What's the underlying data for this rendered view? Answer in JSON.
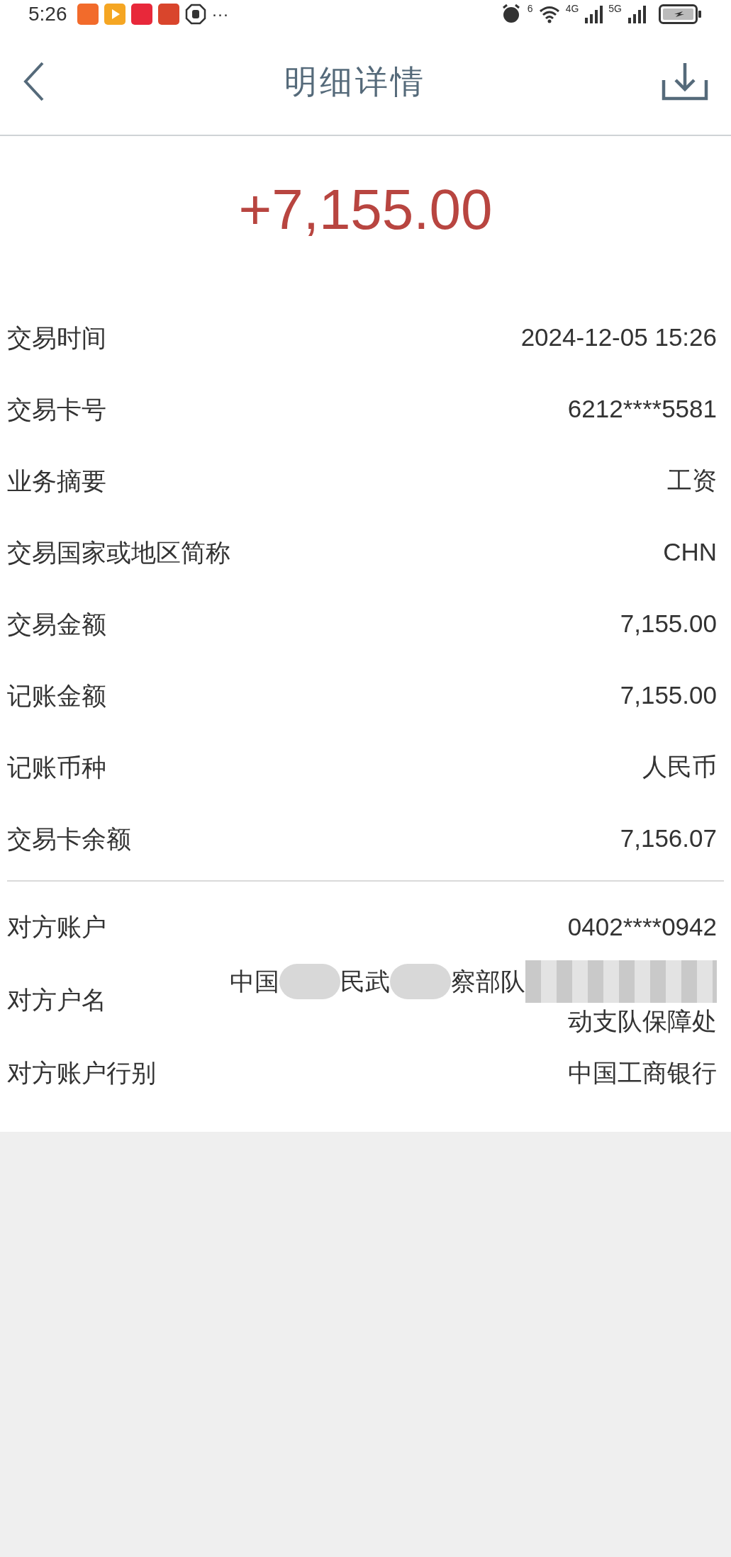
{
  "status_bar": {
    "time": "5:26",
    "more": "···",
    "wifi_badge": "6",
    "sim1": "4G",
    "sim2": "5G"
  },
  "header": {
    "title": "明细详情"
  },
  "amount": "+7,155.00",
  "details": [
    {
      "label": "交易时间",
      "value": "2024-12-05 15:26"
    },
    {
      "label": "交易卡号",
      "value": "6212****5581"
    },
    {
      "label": "业务摘要",
      "value": "工资"
    },
    {
      "label": "交易国家或地区简称",
      "value": "CHN"
    },
    {
      "label": "交易金额",
      "value": "7,155.00"
    },
    {
      "label": "记账金额",
      "value": "7,155.00"
    },
    {
      "label": "记账币种",
      "value": "人民币"
    },
    {
      "label": "交易卡余额",
      "value": "7,156.07"
    }
  ],
  "counterparty": [
    {
      "kind": "text",
      "label": "对方账户",
      "value": "0402****0942"
    },
    {
      "kind": "redacted",
      "label": "对方户名",
      "line1": [
        "中国",
        "民武",
        "察部队"
      ],
      "line2": "动支队保障处"
    },
    {
      "kind": "text",
      "label": "对方账户行别",
      "value": "中国工商银行"
    }
  ]
}
